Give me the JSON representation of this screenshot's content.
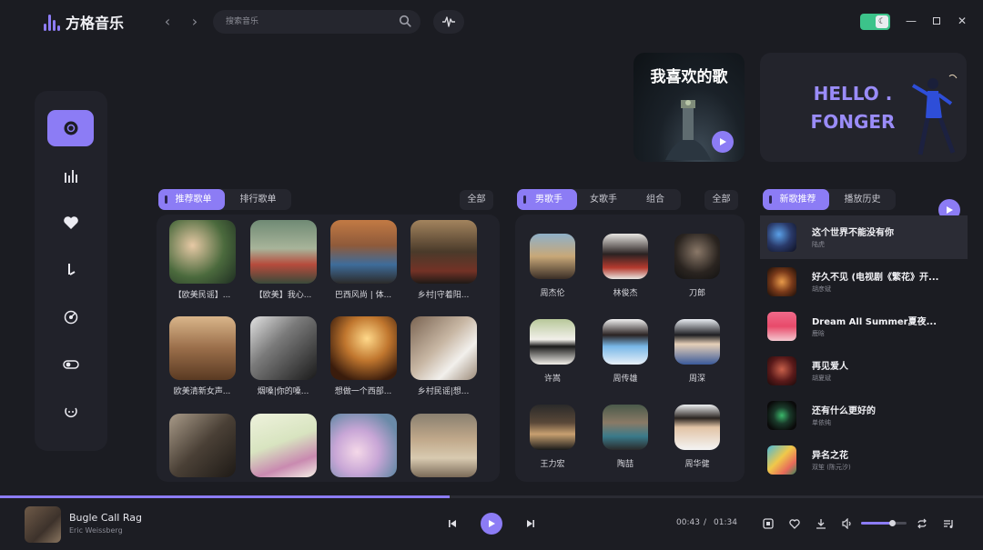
{
  "app": {
    "title": "方格音乐"
  },
  "search": {
    "placeholder": "搜索音乐"
  },
  "banner": {
    "favorites_title": "我喜欢的歌",
    "hello_line1": "HELLO .",
    "hello_line2": "FONGER"
  },
  "playlists": {
    "tabs": [
      "推荐歌单",
      "排行歌单"
    ],
    "all_label": "全部",
    "progress_hint": "",
    "items": [
      {
        "caption": "【欧美民谣】..."
      },
      {
        "caption": "【欧美】我心..."
      },
      {
        "caption": "巴西风尚 | 体..."
      },
      {
        "caption": "乡村|守着阳..."
      },
      {
        "caption": "欧美清新女声..."
      },
      {
        "caption": "烟嗓|你的嗓..."
      },
      {
        "caption": "想做一个西部..."
      },
      {
        "caption": "乡村民谣|想..."
      },
      {
        "caption": ""
      },
      {
        "caption": ""
      },
      {
        "caption": ""
      },
      {
        "caption": ""
      }
    ]
  },
  "singers": {
    "tabs": [
      "男歌手",
      "女歌手",
      "组合"
    ],
    "all_label": "全部",
    "items": [
      {
        "name": "周杰伦"
      },
      {
        "name": "林俊杰"
      },
      {
        "name": "刀郎"
      },
      {
        "name": "许嵩"
      },
      {
        "name": "周传雄"
      },
      {
        "name": "周深"
      },
      {
        "name": "王力宏"
      },
      {
        "name": "陶喆"
      },
      {
        "name": "周华健"
      }
    ]
  },
  "new_songs": {
    "tabs": [
      "新歌推荐",
      "播放历史"
    ],
    "items": [
      {
        "title": "这个世界不能没有你",
        "artist": "陆虎"
      },
      {
        "title": "好久不见 (电视剧《繁花》开...",
        "artist": "胡彦斌"
      },
      {
        "title": "Dream All Summer夏夜...",
        "artist": "鹿晗"
      },
      {
        "title": "再见爱人",
        "artist": "胡夏斌"
      },
      {
        "title": "还有什么更好的",
        "artist": "单依纯"
      },
      {
        "title": "异名之花",
        "artist": "双笙 (陈元汐)"
      }
    ]
  },
  "player": {
    "title": "Bugle Call Rag",
    "artist": "Eric Weissberg",
    "current_time": "00:43",
    "separator": "/",
    "total_time": "01:34",
    "progress": 0.457,
    "volume": 0.72
  },
  "colors": {
    "accent": "#8c7cf5",
    "background": "#1b1c22",
    "panel": "#21222a",
    "toggle": "#3cc38a"
  }
}
